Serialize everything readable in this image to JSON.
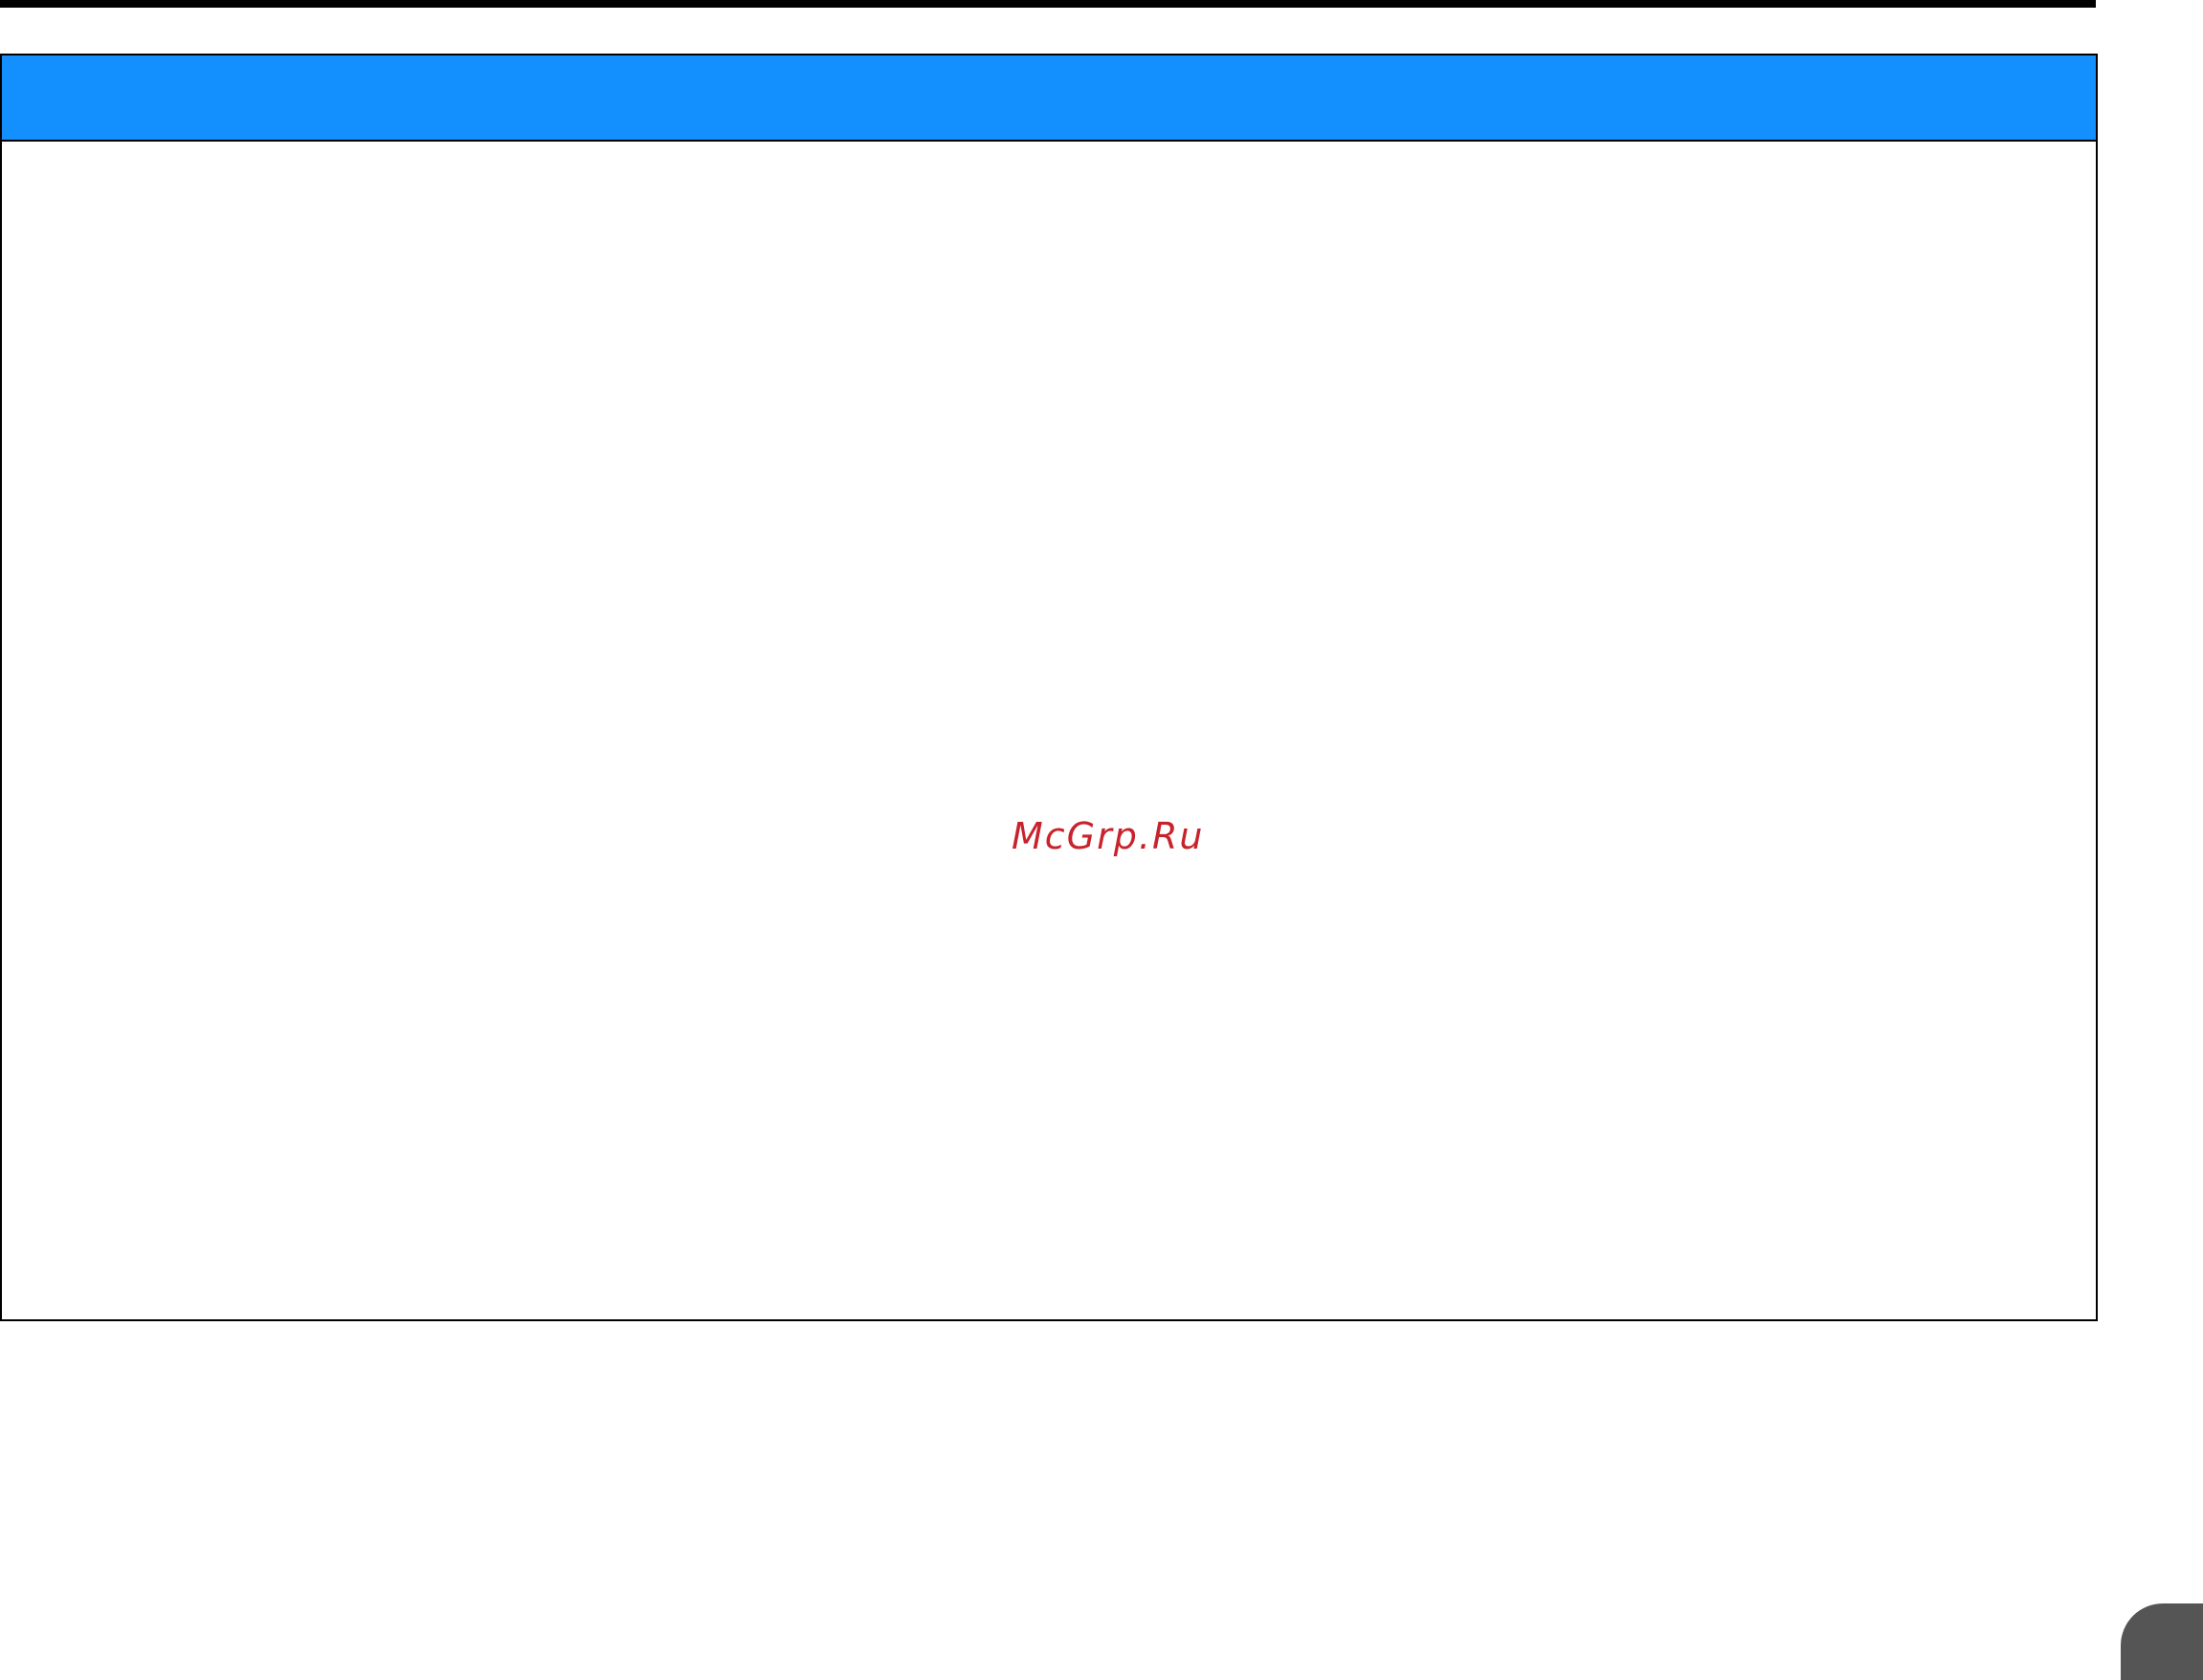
{
  "colors": {
    "header_band": "#148ffe",
    "rule": "#000000",
    "watermark_text": "#c8232c",
    "page_tab": "#555555"
  },
  "watermark": {
    "text": "McGrp.Ru"
  }
}
